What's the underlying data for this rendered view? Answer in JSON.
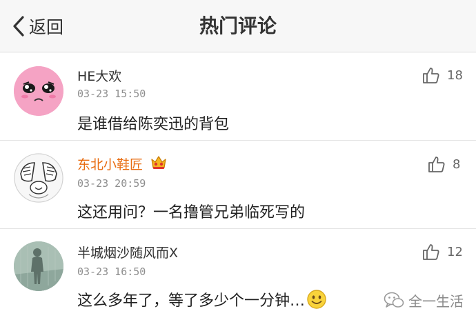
{
  "navbar": {
    "back_label": "返回",
    "title": "热门评论"
  },
  "comments": [
    {
      "username": "HE大欢",
      "time": "03-23 15:50",
      "text": "是谁借给陈奕迅的背包",
      "likes": "18",
      "vip": false,
      "avatar": "pink-crying-face"
    },
    {
      "username": "东北小鞋匠",
      "time": "03-23 20:59",
      "text": "这还用问？一名撸管兄弟临死写的",
      "likes": "8",
      "vip": true,
      "avatar": "cartoon-covering-face"
    },
    {
      "username": "半城烟沙随风而X",
      "time": "03-23 16:50",
      "text": "这么多年了，等了多少个一分钟…",
      "likes": "12",
      "vip": false,
      "avatar": "silhouette-shadow"
    }
  ],
  "watermark": {
    "label": "全一生活",
    "icon": "wechat-icon"
  },
  "colors": {
    "vip_name": "#e86b0f",
    "navbar_bg": "#f7f7f7",
    "time": "#8e8e8e"
  }
}
